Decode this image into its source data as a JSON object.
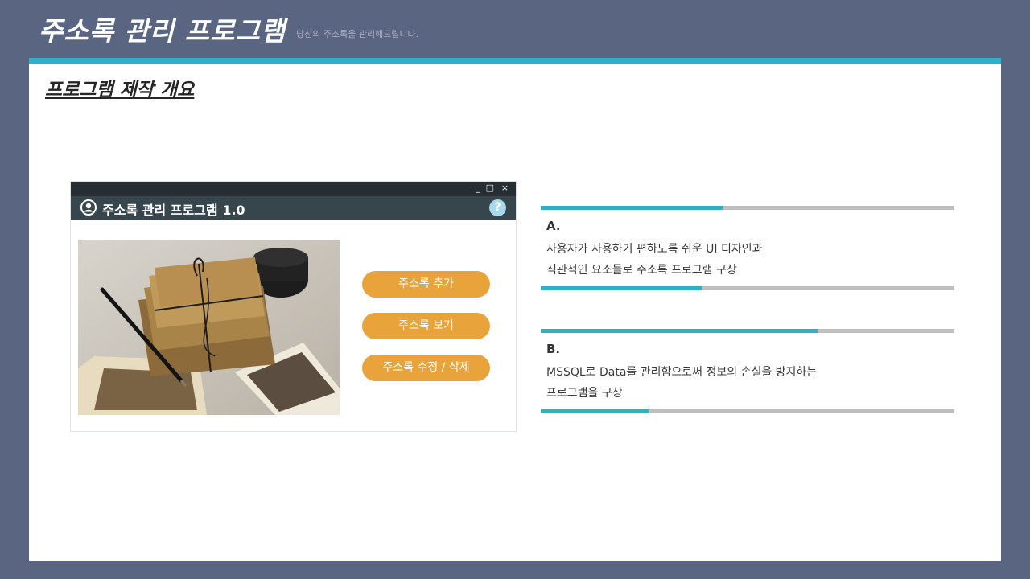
{
  "header": {
    "title": "주소록 관리 프로그램",
    "subtitle": "당신의 주소록을 관리해드립니다."
  },
  "section": {
    "title": "프로그램 제작 개요"
  },
  "app_window": {
    "controls": {
      "minimize": "_",
      "maximize": "□",
      "close": "×"
    },
    "title": "주소록 관리 프로그램 1.0",
    "help_label": "?",
    "buttons": {
      "add": "주소록 추가",
      "view": "주소록 보기",
      "edit": "주소록 수정 / 삭제"
    }
  },
  "info_blocks": [
    {
      "label": "A.",
      "lines": [
        "사용자가 사용하기 편하도록 쉬운 UI 디자인과",
        "직관적인 요소들로 주소록 프로그램 구상"
      ],
      "top_progress": 0.44,
      "bottom_progress": 0.39
    },
    {
      "label": "B.",
      "lines": [
        "MSSQL로 Data를 관리함으로써 정보의 손실을 방지하는",
        "프로그램을 구상"
      ],
      "top_progress": 0.67,
      "bottom_progress": 0.26
    }
  ],
  "colors": {
    "accent": "#2fb0c9",
    "button": "#e8a33a",
    "background": "#5a6581",
    "app_header": "#37464d",
    "track": "#bfbfbf"
  }
}
